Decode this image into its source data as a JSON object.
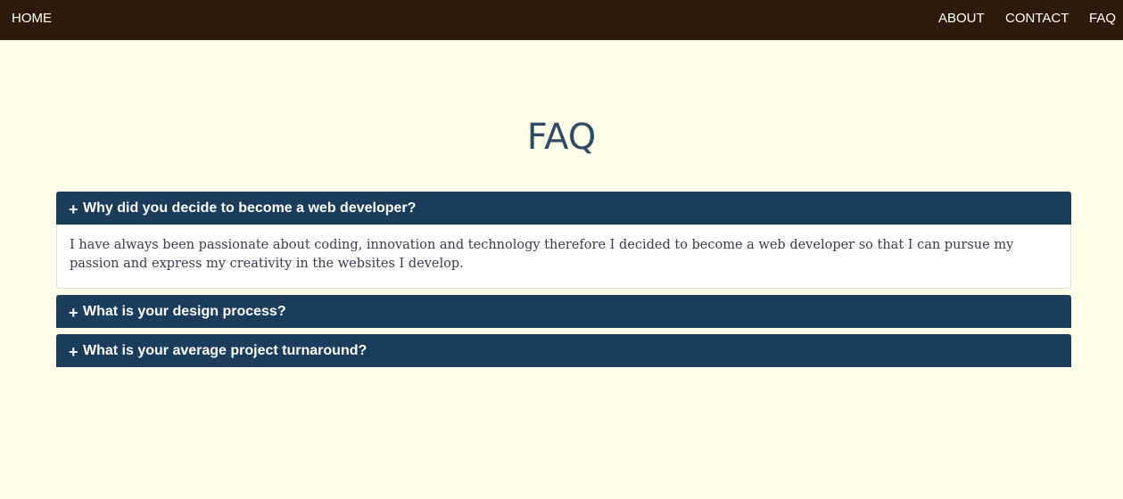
{
  "nav": {
    "home": "HOME",
    "about": "ABOUT",
    "contact": "CONTACT",
    "faq": "FAQ"
  },
  "page": {
    "title": "FAQ"
  },
  "faq": {
    "items": [
      {
        "icon": "+",
        "question": "Why did you decide to become a web developer?",
        "answer": "I have always been passionate about coding, innovation and technology therefore I decided to become a web developer so that I can pursue my passion and express my creativity in the websites I develop.",
        "expanded": true
      },
      {
        "icon": "+",
        "question": "What is your design process?",
        "expanded": false
      },
      {
        "icon": "+",
        "question": "What is your average project turnaround?",
        "expanded": false
      }
    ]
  },
  "colors": {
    "navbar_bg": "#2C1A0A",
    "page_bg": "#FFFFE9",
    "title": "#2E4A66",
    "accordion_header": "#1B3D5C",
    "answer_text": "#3A3A4A"
  }
}
